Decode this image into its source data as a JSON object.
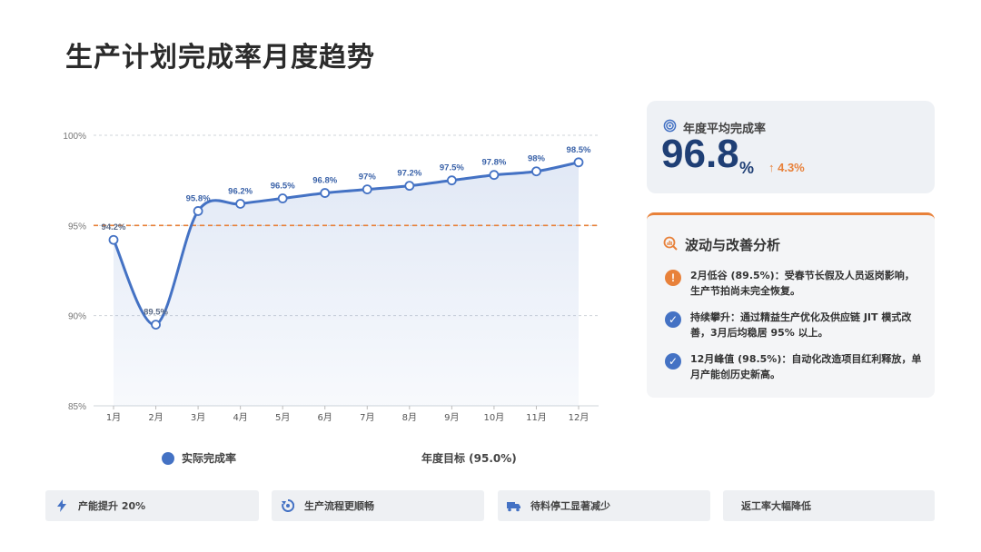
{
  "page": {
    "title": "生产计划完成率月度趋势"
  },
  "chart_data": {
    "type": "line",
    "categories": [
      "1月",
      "2月",
      "3月",
      "4月",
      "5月",
      "6月",
      "7月",
      "8月",
      "9月",
      "10月",
      "11月",
      "12月"
    ],
    "series": [
      {
        "name": "实际完成率",
        "values": [
          94.2,
          89.5,
          95.8,
          96.2,
          96.5,
          96.8,
          97.0,
          97.2,
          97.5,
          97.8,
          98.0,
          98.5
        ],
        "color": "#4472c4"
      }
    ],
    "data_labels": [
      "94.2%",
      "89.5%",
      "95.8%",
      "96.2%",
      "96.5%",
      "96.8%",
      "97%",
      "97.2%",
      "97.5%",
      "97.8%",
      "98%",
      "98.5%"
    ],
    "target": {
      "name": "年度目标 (95.0%)",
      "value": 95.0,
      "color": "#e8813a"
    },
    "ylim": [
      85,
      100
    ],
    "yticks": [
      85,
      90,
      95,
      100
    ],
    "ytick_labels": [
      "85%",
      "90%",
      "95%",
      "100%"
    ],
    "grid": true,
    "legend_position": "bottom"
  },
  "legend": {
    "actual_label": "实际完成率",
    "target_label": "年度目标 (95.0%)"
  },
  "avg_card": {
    "label": "年度平均完成率",
    "value": "96.8",
    "unit": "%",
    "delta": "↑ 4.3%",
    "icon": "target-icon"
  },
  "analysis": {
    "title": "波动与改善分析",
    "icon": "analysis-chart-icon",
    "items": [
      {
        "icon": "warning-icon",
        "symbol": "!",
        "text": "2月低谷 (89.5%)：受春节长假及人员返岗影响，生产节拍尚未完全恢复。"
      },
      {
        "icon": "check-icon",
        "symbol": "✓",
        "text": "持续攀升：通过精益生产优化及供应链 JIT 模式改善，3月后均稳居 95% 以上。"
      },
      {
        "icon": "check-icon",
        "symbol": "✓",
        "text": "12月峰值 (98.5%)：自动化改造项目红利释放，单月产能创历史新高。"
      }
    ]
  },
  "bottom_items": [
    {
      "icon": "lightning-icon",
      "symbol": "⚡",
      "label": "产能提升 20%"
    },
    {
      "icon": "recycle-icon",
      "symbol": "♻",
      "label": "生产流程更顺畅"
    },
    {
      "icon": "truck-icon",
      "symbol": "🚚",
      "label": "待料停工显著减少"
    },
    {
      "icon": "",
      "symbol": "",
      "label": "返工率大幅降低"
    }
  ],
  "colors": {
    "accent": "#4472c4",
    "orange": "#e8813a",
    "dark_blue": "#1f3f75"
  }
}
